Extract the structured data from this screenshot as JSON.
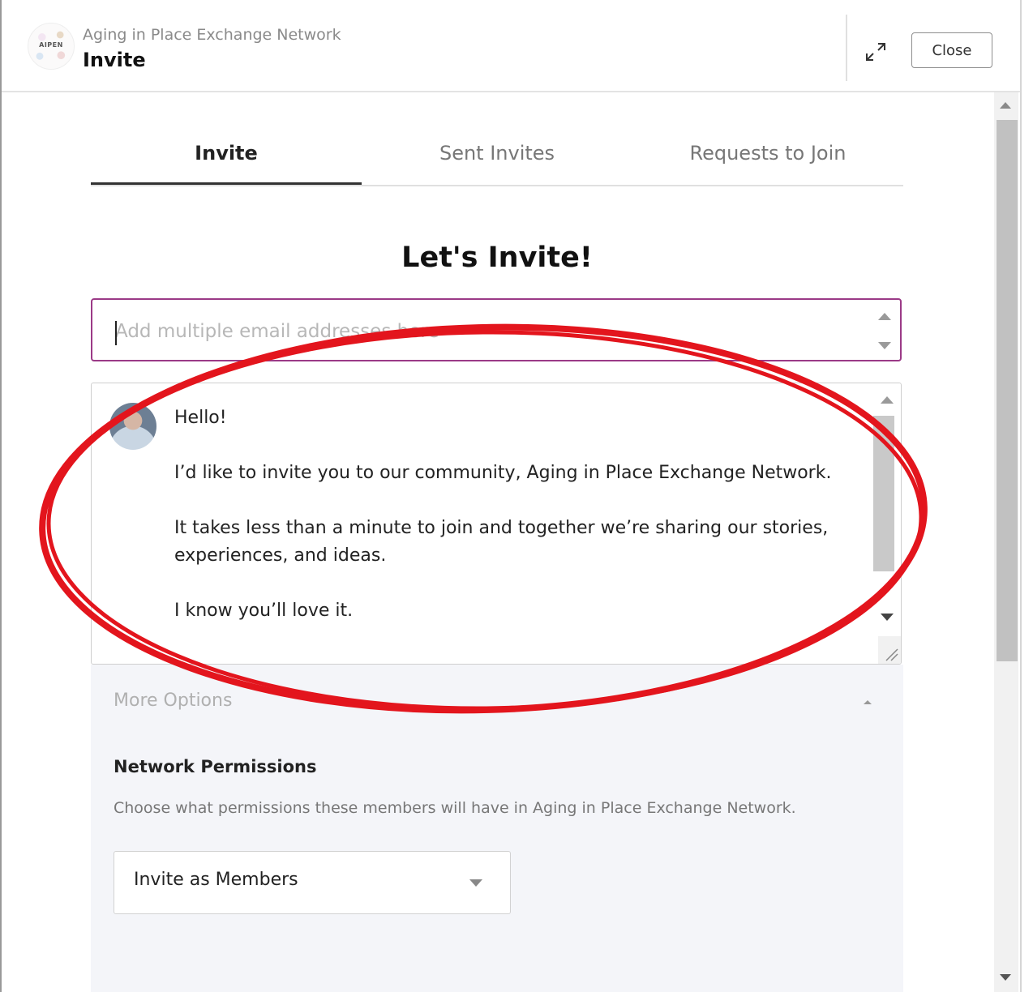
{
  "header": {
    "app_title": "Aging in Place Exchange Network",
    "logo_text": "AIPEN",
    "page_title": "Invite",
    "close_label": "Close"
  },
  "tabs": [
    {
      "label": "Invite",
      "active": true
    },
    {
      "label": "Sent Invites",
      "active": false
    },
    {
      "label": "Requests to Join",
      "active": false
    }
  ],
  "heading": "Let's Invite!",
  "email_input": {
    "placeholder": "Add multiple email addresses here",
    "value": ""
  },
  "message": {
    "line1": "Hello!",
    "line2": "I’d like to invite you to our community, Aging in Place Exchange Network.",
    "line3": "It takes less than a minute to join and together we’re sharing our stories,",
    "line4": "experiences, and ideas.",
    "line5": "I know you’ll love it."
  },
  "options": {
    "more_options_label": "More Options",
    "permissions_title": "Network Permissions",
    "permissions_description": "Choose what permissions these members will have in Aging in Place Exchange Network.",
    "permission_selected": "Invite as Members"
  },
  "icons": {
    "expand": "expand-icon",
    "select": "chevron-down-icon",
    "collapse": "chevron-up-icon"
  },
  "colors": {
    "accent_border": "#9b3a87",
    "annotation_red": "#e3151d",
    "options_bg": "#f4f5f9"
  }
}
